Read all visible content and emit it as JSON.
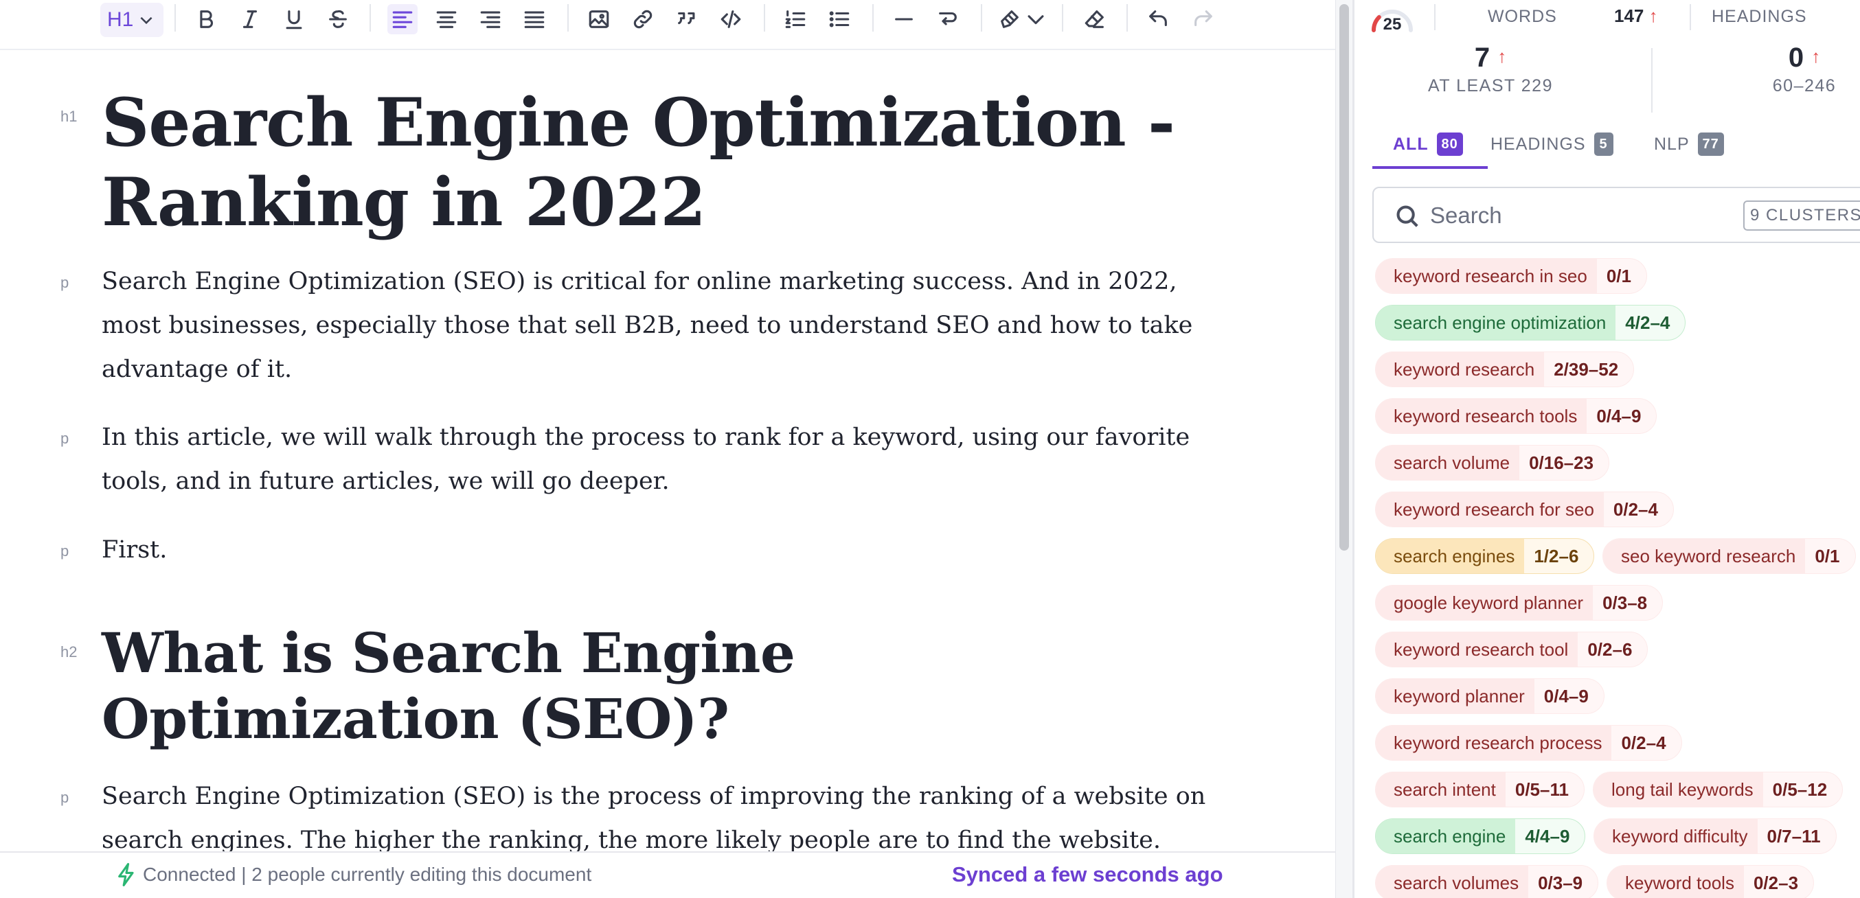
{
  "toolbar": {
    "heading_level": "H1",
    "underline_letter": "U"
  },
  "document": {
    "blocks": [
      {
        "type": "h1",
        "text": "Search Engine Optimization - Ranking in 2022"
      },
      {
        "type": "p",
        "text": "Search Engine Optimization (SEO) is critical for online marketing success. And in 2022, most businesses, especially those that sell B2B, need to understand SEO and how to take advantage of it."
      },
      {
        "type": "p",
        "text": "In this article, we will walk through the process to rank for a keyword, using our favorite tools, and in future articles, we will go deeper."
      },
      {
        "type": "p",
        "text": "First."
      },
      {
        "type": "h2",
        "text": "What is Search Engine Optimization (SEO)?"
      },
      {
        "type": "p",
        "text": "Search Engine Optimization (SEO) is the process of improving the ranking of a website on search engines. The higher the ranking, the more likely people are to find the website."
      }
    ],
    "tags": {
      "h1": "h1",
      "h2": "h2",
      "p": "p"
    }
  },
  "status": {
    "connection": "Connected | 2 people currently editing this document",
    "sync": "Synced a few seconds ago"
  },
  "panel": {
    "score": "25",
    "score_fraction": 0.25,
    "words_label": "WORDS",
    "words_value": "147",
    "headings_label": "HEADINGS",
    "up_arrow": "↑",
    "stat_a": {
      "value": "7",
      "sub": "AT LEAST 229"
    },
    "stat_b": {
      "value": "0",
      "sub": "60–246"
    },
    "tabs": [
      {
        "label": "ALL",
        "count": "80"
      },
      {
        "label": "HEADINGS",
        "count": "5"
      },
      {
        "label": "NLP",
        "count": "77"
      }
    ],
    "search": {
      "placeholder": "Search",
      "cluster_button": "9 CLUSTERS"
    },
    "keywords": [
      {
        "term": "keyword research in seo",
        "count": "0/1",
        "status": "red"
      },
      {
        "term": "search engine optimization",
        "count": "4/2–4",
        "status": "green"
      },
      {
        "term": "keyword research",
        "count": "2/39–52",
        "status": "red"
      },
      {
        "term": "keyword research tools",
        "count": "0/4–9",
        "status": "red"
      },
      {
        "term": "search volume",
        "count": "0/16–23",
        "status": "red"
      },
      {
        "term": "keyword research for seo",
        "count": "0/2–4",
        "status": "red"
      },
      {
        "term": "search engines",
        "count": "1/2–6",
        "status": "orange"
      },
      {
        "term": "seo keyword research",
        "count": "0/1",
        "status": "red"
      },
      {
        "term": "google keyword planner",
        "count": "0/3–8",
        "status": "red"
      },
      {
        "term": "keyword research tool",
        "count": "0/2–6",
        "status": "red"
      },
      {
        "term": "keyword planner",
        "count": "0/4–9",
        "status": "red"
      },
      {
        "term": "keyword research process",
        "count": "0/2–4",
        "status": "red"
      },
      {
        "term": "search intent",
        "count": "0/5–11",
        "status": "red"
      },
      {
        "term": "long tail keywords",
        "count": "0/5–12",
        "status": "red"
      },
      {
        "term": "search engine",
        "count": "4/4–9",
        "status": "green"
      },
      {
        "term": "keyword difficulty",
        "count": "0/7–11",
        "status": "red"
      },
      {
        "term": "search volumes",
        "count": "0/3–9",
        "status": "red"
      },
      {
        "term": "keyword tools",
        "count": "0/2–3",
        "status": "red"
      }
    ]
  },
  "colors": {
    "accent": "#6c3fd1",
    "good": "#2bb673",
    "warn": "#f2b544",
    "bad": "#e24747"
  }
}
